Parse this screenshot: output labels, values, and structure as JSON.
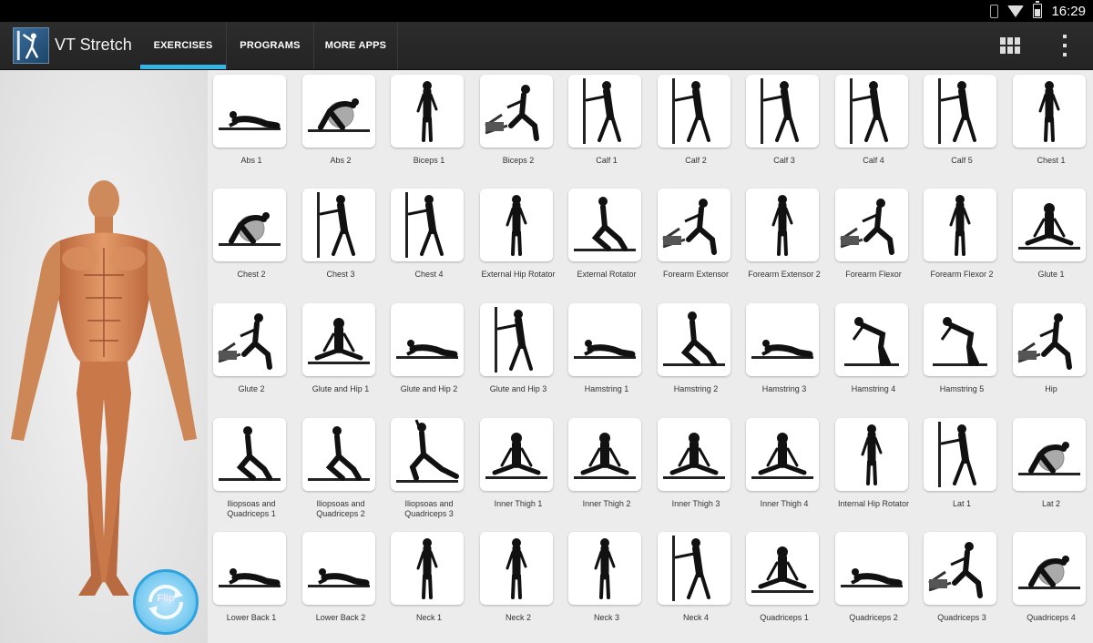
{
  "status_bar": {
    "time": "16:29"
  },
  "app": {
    "title": "VT Stretch"
  },
  "tabs": [
    {
      "label": "EXERCISES",
      "active": true
    },
    {
      "label": "PROGRAMS",
      "active": false
    },
    {
      "label": "MORE APPS",
      "active": false
    }
  ],
  "actions": {
    "grid_view_icon": "grid-view-icon",
    "overflow_icon": "overflow-icon"
  },
  "rotate_button": {
    "label": "Flip"
  },
  "accent_color": "#33b5e5",
  "exercises": [
    {
      "label": "Abs 1",
      "pose": "lying"
    },
    {
      "label": "Abs 2",
      "pose": "ball"
    },
    {
      "label": "Biceps 1",
      "pose": "standing"
    },
    {
      "label": "Biceps 2",
      "pose": "machine"
    },
    {
      "label": "Calf 1",
      "pose": "wall"
    },
    {
      "label": "Calf 2",
      "pose": "wall"
    },
    {
      "label": "Calf 3",
      "pose": "wall"
    },
    {
      "label": "Calf 4",
      "pose": "wall"
    },
    {
      "label": "Calf 5",
      "pose": "wall"
    },
    {
      "label": "Chest 1",
      "pose": "standing"
    },
    {
      "label": "Chest 2",
      "pose": "ball"
    },
    {
      "label": "Chest 3",
      "pose": "wall"
    },
    {
      "label": "Chest 4",
      "pose": "wall"
    },
    {
      "label": "External Hip Rotator",
      "pose": "standing"
    },
    {
      "label": "External Rotator",
      "pose": "kneel"
    },
    {
      "label": "Forearm Extensor",
      "pose": "machine"
    },
    {
      "label": "Forearm Extensor 2",
      "pose": "standing"
    },
    {
      "label": "Forearm Flexor",
      "pose": "machine"
    },
    {
      "label": "Forearm Flexor 2",
      "pose": "standing"
    },
    {
      "label": "Glute 1",
      "pose": "seated"
    },
    {
      "label": "Glute 2",
      "pose": "machine"
    },
    {
      "label": "Glute and Hip 1",
      "pose": "seated"
    },
    {
      "label": "Glute and Hip 2",
      "pose": "lying"
    },
    {
      "label": "Glute and Hip 3",
      "pose": "wall"
    },
    {
      "label": "Hamstring 1",
      "pose": "lying"
    },
    {
      "label": "Hamstring 2",
      "pose": "kneel"
    },
    {
      "label": "Hamstring 3",
      "pose": "lying"
    },
    {
      "label": "Hamstring 4",
      "pose": "bend"
    },
    {
      "label": "Hamstring 5",
      "pose": "bend"
    },
    {
      "label": "Hip",
      "pose": "machine"
    },
    {
      "label": "Iliopsoas and Quadriceps 1",
      "pose": "kneel"
    },
    {
      "label": "Iliopsoas and Quadriceps 2",
      "pose": "kneel"
    },
    {
      "label": "Iliopsoas and Quadriceps 3",
      "pose": "lunge"
    },
    {
      "label": "Inner Thigh 1",
      "pose": "seated"
    },
    {
      "label": "Inner Thigh 2",
      "pose": "seated"
    },
    {
      "label": "Inner Thigh 3",
      "pose": "seated"
    },
    {
      "label": "Inner Thigh 4",
      "pose": "seated"
    },
    {
      "label": "Internal Hip Rotator",
      "pose": "standing"
    },
    {
      "label": "Lat 1",
      "pose": "wall"
    },
    {
      "label": "Lat 2",
      "pose": "ball"
    },
    {
      "label": "Lower Back 1",
      "pose": "lying"
    },
    {
      "label": "Lower Back 2",
      "pose": "lying"
    },
    {
      "label": "Neck 1",
      "pose": "standing"
    },
    {
      "label": "Neck 2",
      "pose": "standing"
    },
    {
      "label": "Neck 3",
      "pose": "standing"
    },
    {
      "label": "Neck 4",
      "pose": "wall"
    },
    {
      "label": "Quadriceps 1",
      "pose": "seated"
    },
    {
      "label": "Quadriceps 2",
      "pose": "lying"
    },
    {
      "label": "Quadriceps 3",
      "pose": "machine"
    },
    {
      "label": "Quadriceps 4",
      "pose": "ball"
    }
  ]
}
